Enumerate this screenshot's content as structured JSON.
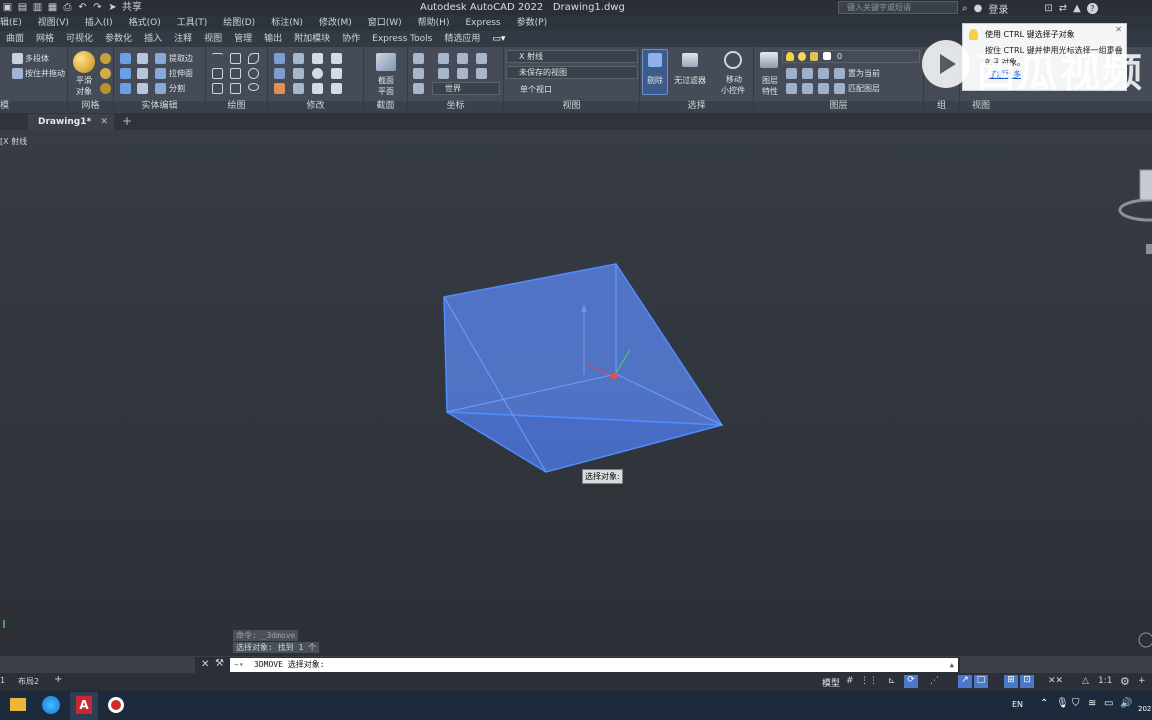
{
  "app": {
    "title": "Autodesk AutoCAD 2022",
    "filename": "Drawing1.dwg",
    "share_label": "共享",
    "search_placeholder": "键入关键字或短语",
    "login_label": "登录"
  },
  "menu": [
    "辑(E)",
    "视图(V)",
    "插入(I)",
    "格式(O)",
    "工具(T)",
    "绘图(D)",
    "标注(N)",
    "修改(M)",
    "窗口(W)",
    "帮助(H)",
    "Express",
    "参数(P)"
  ],
  "ribbon_tabs": [
    "曲面",
    "网格",
    "可视化",
    "参数化",
    "插入",
    "注释",
    "视图",
    "管理",
    "输出",
    "附加模块",
    "协作",
    "Express Tools",
    "精选应用"
  ],
  "ribbon": {
    "model": {
      "polysolid": "多段体",
      "presspull": "按住并拖动",
      "label": "模"
    },
    "smooth": {
      "line1": "平滑",
      "line2": "对象",
      "label": "网格"
    },
    "solid_edit": {
      "extract": "提取边",
      "extrude_face": "拉伸面",
      "separate": "分割",
      "label": "实体编辑"
    },
    "draw": {
      "label": "绘图"
    },
    "modify": {
      "label": "修改"
    },
    "section": {
      "line1": "截面",
      "line2": "平面",
      "label": "截面"
    },
    "coords": {
      "world": "世界",
      "label": "坐标"
    },
    "view": {
      "visual": "X 射线",
      "saved": "未保存的视图",
      "single": "单个视口",
      "label": "视图"
    },
    "selection": {
      "cull": "剔除",
      "nofilter": "无过滤器",
      "move_gizmo1": "移动",
      "move_gizmo2": "小控件",
      "label": "选择"
    },
    "layers": {
      "props1": "图层",
      "props2": "特性",
      "layer0": "0",
      "setcurrent": "置为当前",
      "match": "匹配图层",
      "label": "图层"
    },
    "groups": {
      "label": "组"
    },
    "view2": {
      "label": "视图"
    }
  },
  "file_tab": {
    "name": "Drawing1*",
    "close": "✕",
    "add": "+"
  },
  "viewport_label": "X 射线",
  "tooltip": {
    "title": "使用 CTRL 键选择子对象",
    "body": "按住 CTRL 键并使用光标选择一组重叠的子对象。",
    "link": "了解更多"
  },
  "watermark": "西瓜视频",
  "select_prompt": "选择对象:",
  "command_history": [
    "命令: _3dmove",
    "选择对象: 找到 1 个"
  ],
  "command_input": "3DMOVE 选择对象:",
  "layout_tabs": [
    "1",
    "布局2",
    "+"
  ],
  "status": {
    "model": "模型",
    "scale": "1:1"
  },
  "taskbar": {
    "lang": "EN",
    "year": "202"
  },
  "colors": {
    "accent": "#5b7fd3",
    "edge": "#4f8cff",
    "face": "rgba(88,132,235,0.78)"
  }
}
